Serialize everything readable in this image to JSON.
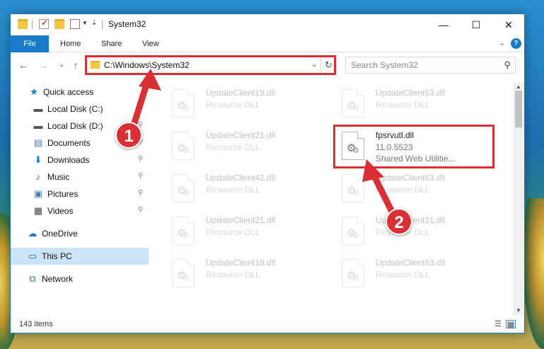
{
  "window": {
    "title": "System32",
    "controls": {
      "minimize": "—",
      "maximize": "☐",
      "close": "✕"
    }
  },
  "ribbon": {
    "tabs": [
      "File",
      "Home",
      "Share",
      "View"
    ],
    "expand_glyph": "⌄",
    "help_glyph": "?"
  },
  "nav": {
    "back": "←",
    "forward": "→",
    "recent": "⌄",
    "up": "↑",
    "address": "C:\\Windows\\System32",
    "address_dropdown": "⌄",
    "refresh": "↻",
    "search_placeholder": "Search System32",
    "search_icon": "⚲"
  },
  "sidebar": {
    "items": [
      {
        "label": "Quick access",
        "icon": "star-icon",
        "glyph": "★",
        "color": "#1979ca",
        "pinned": false
      },
      {
        "label": "Local Disk (C:)",
        "icon": "drive-icon",
        "glyph": "▬",
        "color": "#555555",
        "pinned": true
      },
      {
        "label": "Local Disk (D:)",
        "icon": "drive-icon",
        "glyph": "▬",
        "color": "#555555",
        "pinned": true
      },
      {
        "label": "Documents",
        "icon": "documents-icon",
        "glyph": "▤",
        "color": "#4a7fb5",
        "pinned": true
      },
      {
        "label": "Downloads",
        "icon": "download-icon",
        "glyph": "⬇",
        "color": "#1979ca",
        "pinned": true
      },
      {
        "label": "Music",
        "icon": "music-icon",
        "glyph": "♪",
        "color": "#1979ca",
        "pinned": true
      },
      {
        "label": "Pictures",
        "icon": "pictures-icon",
        "glyph": "▣",
        "color": "#4a7fb5",
        "pinned": true
      },
      {
        "label": "Videos",
        "icon": "videos-icon",
        "glyph": "▦",
        "color": "#444444",
        "pinned": true
      },
      {
        "label": "OneDrive",
        "icon": "cloud-icon",
        "glyph": "☁",
        "color": "#1979ca",
        "pinned": false
      },
      {
        "label": "This PC",
        "icon": "computer-icon",
        "glyph": "▭",
        "color": "#2a6fb5",
        "pinned": false,
        "selected": true
      },
      {
        "label": "Network",
        "icon": "network-icon",
        "glyph": "⧉",
        "color": "#2a6fb5",
        "pinned": false
      }
    ],
    "pin_glyph": "📌"
  },
  "files": [
    {
      "name": "UpdateClient19.dll",
      "type": "Resource DLL",
      "faded": true
    },
    {
      "name": "UpdateClient63.dll",
      "type": "Resource DLL",
      "faded": true
    },
    {
      "name": "UpdateClient21.dll",
      "type": "Resource DLL",
      "faded": true
    },
    {
      "name": "fpsrvutl.dll",
      "version": "11.0.5523",
      "description": "Shared Web Utilitie...",
      "faded": false
    },
    {
      "name": "UpdateClient42.dll",
      "type": "Resource DLL",
      "faded": true
    },
    {
      "name": "UpdateClient63.dll",
      "type": "Resource DLL",
      "faded": true
    },
    {
      "name": "UpdateClient21.dll",
      "type": "Resource DLL",
      "faded": true
    },
    {
      "name": "UpdateClient21.dll",
      "type": "Resource DLL",
      "faded": true
    },
    {
      "name": "UpdateClient19.dll",
      "type": "Resource DLL",
      "faded": true
    },
    {
      "name": "UpdateClient63.dll",
      "type": "Resource DLL",
      "faded": true
    }
  ],
  "statusbar": {
    "item_count": "143 items"
  },
  "annotations": {
    "marker1": "1",
    "marker2": "2",
    "color": "#d93035"
  }
}
